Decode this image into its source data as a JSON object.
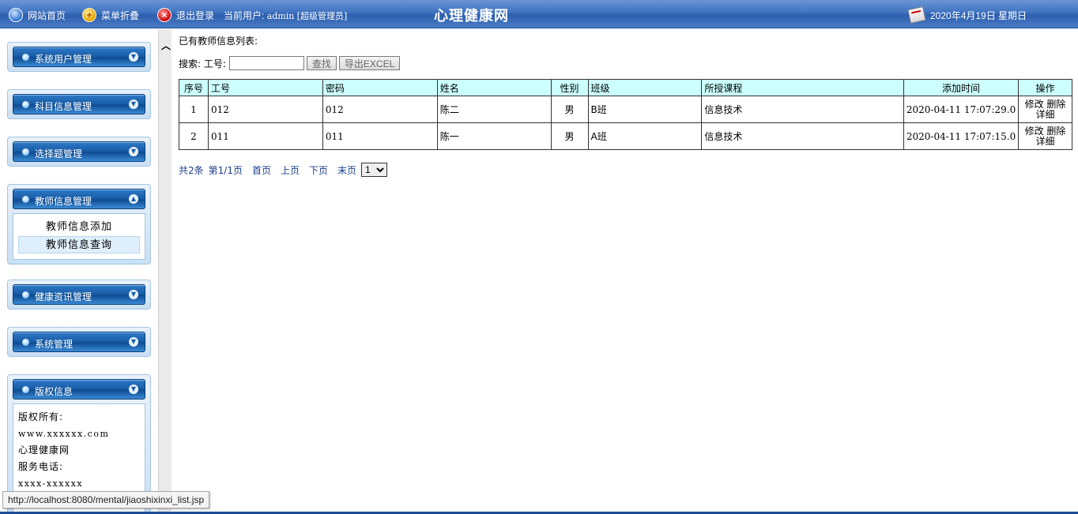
{
  "topbar": {
    "home_label": "网站首页",
    "fold_label": "菜单折叠",
    "logout_label": "退出登录",
    "current_user_prefix": "当前用户:",
    "current_user": "admin",
    "current_role": "[超级管理员]",
    "site_title": "心理健康网",
    "date_text": "2020年4月19日 星期日",
    "icons": {
      "home": "globe-icon",
      "fold": "plus-icon",
      "logout": "close-icon",
      "date": "calendar-icon"
    }
  },
  "sidebar": {
    "panels": [
      {
        "title": "系统用户管理"
      },
      {
        "title": "科目信息管理"
      },
      {
        "title": "选择题管理"
      },
      {
        "title": "教师信息管理",
        "items": [
          "教师信息添加",
          "教师信息查询"
        ],
        "active_item": "教师信息查询"
      },
      {
        "title": "健康资讯管理"
      },
      {
        "title": "系统管理"
      },
      {
        "title": "版权信息"
      }
    ],
    "copyright": {
      "line1": "版权所有:",
      "line2": "www.xxxxxx.com",
      "line3": "心理健康网",
      "line4": "服务电话:",
      "line5": "xxxx-xxxxxx"
    }
  },
  "main": {
    "list_title": "已有教师信息列表:",
    "search_label": "搜索: 工号:",
    "search_value": "",
    "search_button": "查找",
    "export_button": "导出EXCEL",
    "table": {
      "headers": [
        "序号",
        "工号",
        "密码",
        "姓名",
        "性别",
        "班级",
        "所授课程",
        "添加时间",
        "操作"
      ],
      "rows": [
        {
          "index": "1",
          "id": "012",
          "password": "012",
          "name": "陈二",
          "gender": "男",
          "class": "B班",
          "course": "信息技术",
          "added": "2020-04-11 17:07:29.0"
        },
        {
          "index": "2",
          "id": "011",
          "password": "011",
          "name": "陈一",
          "gender": "男",
          "class": "A班",
          "course": "信息技术",
          "added": "2020-04-11 17:07:15.0"
        }
      ],
      "ops": {
        "edit": "修改",
        "delete": "删除",
        "detail": "详细"
      }
    },
    "pager": {
      "total": "共2条",
      "page": "第1/1页",
      "first": "首页",
      "prev": "上页",
      "next": "下页",
      "last": "末页",
      "select_value": "1"
    }
  },
  "status_url": "http://localhost:8080/mental/jiaoshixinxi_list.jsp"
}
